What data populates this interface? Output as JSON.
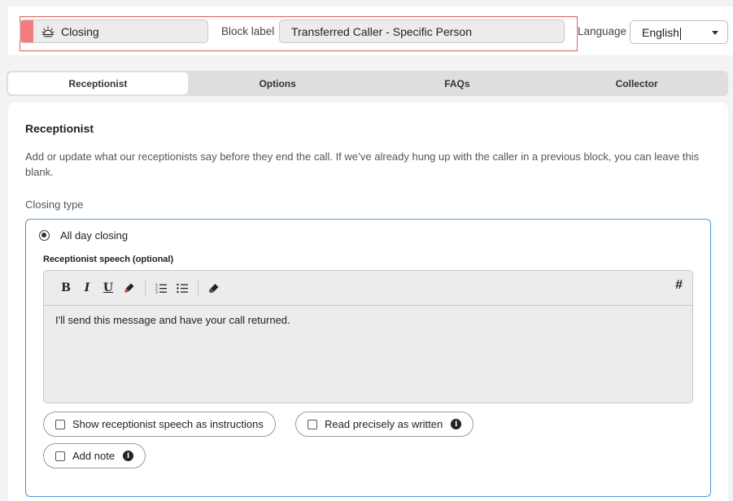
{
  "header": {
    "block_type": "Closing",
    "block_label_caption": "Block label",
    "block_label_value": "Transferred Caller - Specific Person",
    "language_caption": "Language",
    "language_value": "English"
  },
  "tabs": [
    {
      "label": "Receptionist",
      "active": true
    },
    {
      "label": "Options",
      "active": false
    },
    {
      "label": "FAQs",
      "active": false
    },
    {
      "label": "Collector",
      "active": false
    }
  ],
  "section": {
    "title": "Receptionist",
    "description": "Add or update what our receptionists say before they end the call. If we’ve already hung up with the caller in a previous block, you can leave this blank.",
    "closing_type_label": "Closing type"
  },
  "closing_option": {
    "radio_label": "All day closing",
    "selected": true,
    "speech_label": "Receptionist speech (optional)",
    "speech_text": "I'll send this message and have your call returned.",
    "toolbar": {
      "bold": "B",
      "italic": "I",
      "underline": "U",
      "variable": "#"
    }
  },
  "checkboxes": {
    "show_instructions": "Show receptionist speech as instructions",
    "read_precisely": "Read precisely as written",
    "add_note": "Add note"
  },
  "colors": {
    "block_swatch": "#f47c7c",
    "selector_outline": "#e45b5b",
    "option_border": "#4a98d8"
  }
}
